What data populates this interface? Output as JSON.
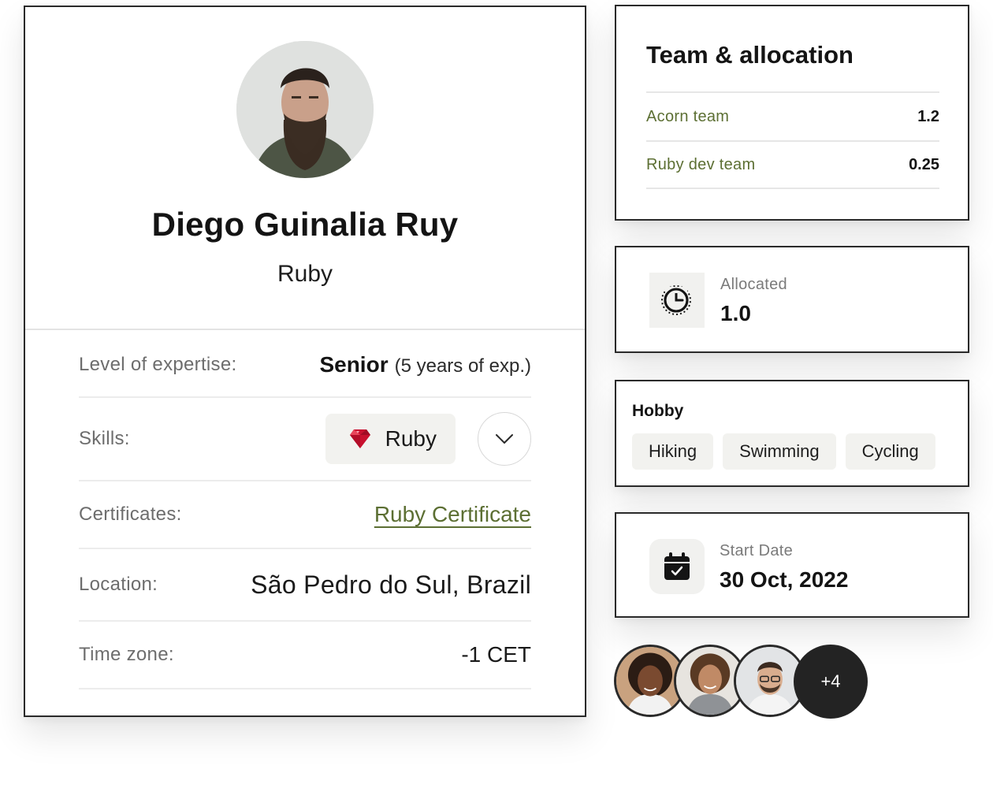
{
  "profile": {
    "name": "Diego Guinalia Ruy",
    "role": "Ruby",
    "avatar_icon": "bearded-man-portrait",
    "details": {
      "expertise_label": "Level of expertise:",
      "expertise_level": "Senior",
      "expertise_years": "(5 years of exp.)",
      "skills_label": "Skills:",
      "skill_name": "Ruby",
      "skill_icon": "ruby-gem-icon",
      "skills_dropdown_icon": "chevron-down-icon",
      "certificates_label": "Certificates:",
      "certificate_link": "Ruby Certificate",
      "location_label": "Location:",
      "location_value": "São Pedro do Sul, Brazil",
      "timezone_label": "Time zone:",
      "timezone_value": "-1 CET"
    }
  },
  "team": {
    "title": "Team & allocation",
    "rows": [
      {
        "name": "Acorn team",
        "value": "1.2"
      },
      {
        "name": "Ruby dev team",
        "value": "0.25"
      }
    ]
  },
  "allocated": {
    "icon": "clock-icon",
    "label": "Allocated",
    "value": "1.0"
  },
  "hobby": {
    "title": "Hobby",
    "tags": [
      "Hiking",
      "Swimming",
      "Cycling"
    ]
  },
  "start_date": {
    "icon": "calendar-check-icon",
    "label": "Start Date",
    "value": "30 Oct, 2022"
  },
  "team_members": {
    "more_count": "+4"
  },
  "colors": {
    "accent_green": "#5c6f33",
    "border": "#2a2a2a",
    "chip_bg": "#f2f2ef",
    "dark_badge": "#232323",
    "ruby_red": "#c8102e"
  }
}
